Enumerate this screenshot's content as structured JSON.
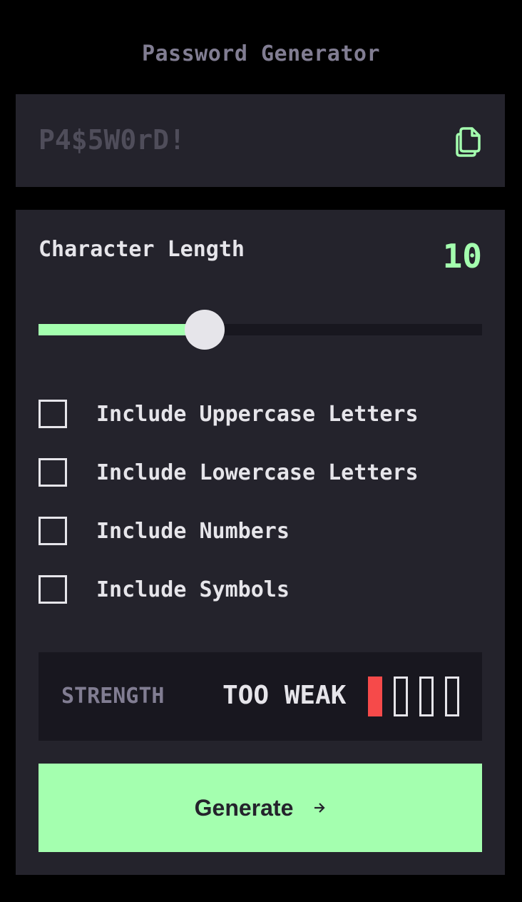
{
  "app": {
    "title": "Password Generator"
  },
  "password": {
    "value": "P4$5W0rD!",
    "copy_icon": "copy-icon"
  },
  "length": {
    "label": "Character Length",
    "value": "10",
    "slider_fraction": 0.375
  },
  "options": [
    {
      "label": "Include Uppercase Letters",
      "checked": false
    },
    {
      "label": "Include Lowercase Letters",
      "checked": false
    },
    {
      "label": "Include Numbers",
      "checked": false
    },
    {
      "label": "Include Symbols",
      "checked": false
    }
  ],
  "strength": {
    "label": "STRENGTH",
    "value": "TOO WEAK",
    "level": 1,
    "max_level": 4
  },
  "generate": {
    "label": "Generate",
    "icon": "arrow-right-icon"
  },
  "colors": {
    "accent": "#a4ffaf",
    "panel": "#24232c",
    "dark": "#18171f",
    "weak": "#f64a4a",
    "muted": "#817d92",
    "text": "#e6e5ea"
  }
}
